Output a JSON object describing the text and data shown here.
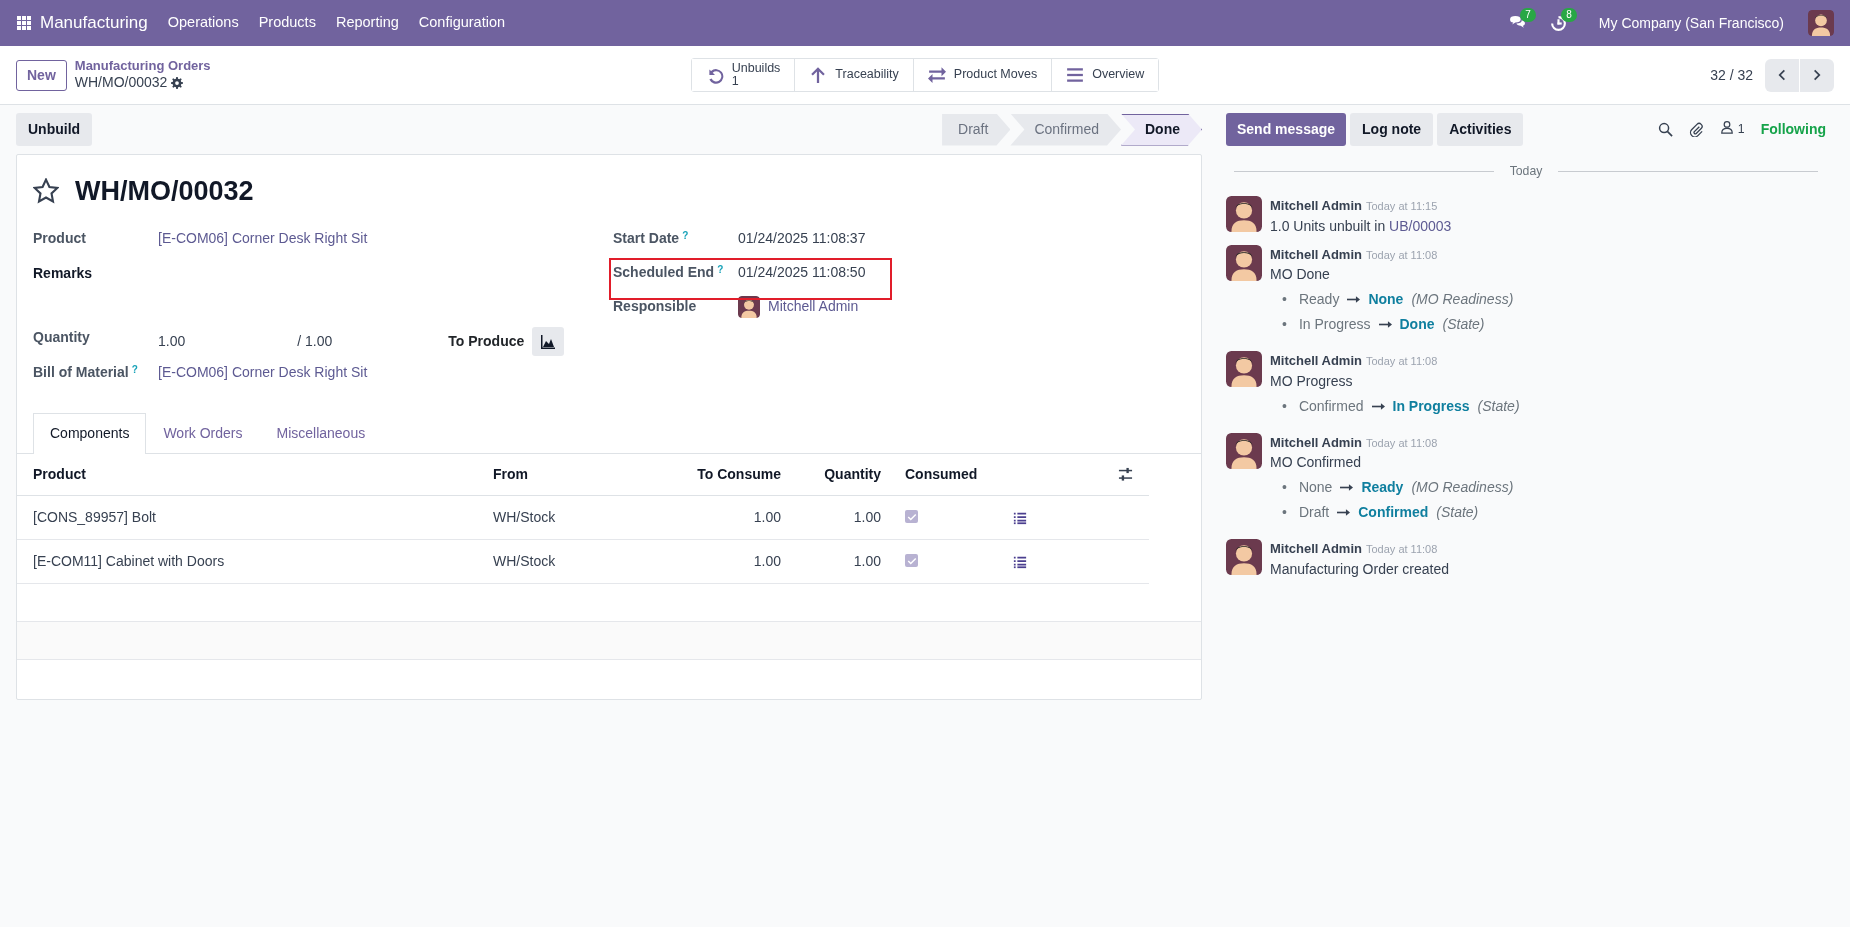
{
  "navbar": {
    "app": "Manufacturing",
    "menus": [
      "Operations",
      "Products",
      "Reporting",
      "Configuration"
    ],
    "messages_badge": "7",
    "activities_badge": "8",
    "company": "My Company (San Francisco)"
  },
  "control_panel": {
    "new_button": "New",
    "breadcrumb": "Manufacturing Orders",
    "record": "WH/MO/00032",
    "smart_buttons": [
      {
        "kind": "undo",
        "label": "Unbuilds",
        "count": "1"
      },
      {
        "kind": "arrow-up",
        "label": "Traceability"
      },
      {
        "kind": "exchange",
        "label": "Product Moves"
      },
      {
        "kind": "menu",
        "label": "Overview"
      }
    ],
    "pager": "32 / 32"
  },
  "action_buttons": [
    "Unbuild"
  ],
  "statusbar": [
    {
      "label": "Draft",
      "selected": false
    },
    {
      "label": "Confirmed",
      "selected": false
    },
    {
      "label": "Done",
      "selected": true
    }
  ],
  "form": {
    "starred": false,
    "title": "WH/MO/00032",
    "left_fields": [
      {
        "kind": "link",
        "label": "Product",
        "value": "[E-COM06] Corner Desk Right Sit"
      },
      {
        "kind": "section",
        "label": "Remarks"
      },
      {
        "kind": "quantity",
        "label": "Quantity",
        "value": "1.00",
        "total": "/ 1.00",
        "unit_label": "To Produce"
      },
      {
        "kind": "link",
        "label": "Bill of Material",
        "help": "?",
        "value": "[E-COM06] Corner Desk Right Sit"
      }
    ],
    "right_fields": [
      {
        "kind": "text",
        "label": "Start Date",
        "help": "?",
        "value": "01/24/2025 11:08:37"
      },
      {
        "kind": "text",
        "label": "Scheduled End",
        "help": "?",
        "value": "01/24/2025 11:08:50",
        "highlighted": true
      },
      {
        "kind": "user",
        "label": "Responsible",
        "value": "Mitchell Admin"
      }
    ]
  },
  "tabs": [
    {
      "label": "Components",
      "selected": true
    },
    {
      "label": "Work Orders",
      "selected": false
    },
    {
      "label": "Miscellaneous",
      "selected": false
    }
  ],
  "table": {
    "columns": [
      "Product",
      "From",
      "To Consume",
      "Quantity",
      "Consumed"
    ],
    "rows": [
      {
        "product": "[CONS_89957] Bolt",
        "from": "WH/Stock",
        "to_consume": "1.00",
        "quantity": "1.00",
        "consumed": true
      },
      {
        "product": "[E-COM11] Cabinet with Doors",
        "from": "WH/Stock",
        "to_consume": "1.00",
        "quantity": "1.00",
        "consumed": true
      }
    ]
  },
  "chatter": {
    "buttons": [
      {
        "label": "Send message",
        "selected": true
      },
      {
        "label": "Log note",
        "selected": false
      },
      {
        "label": "Activities",
        "selected": false
      }
    ],
    "followers_count": "1",
    "follow_label": "Following",
    "date_separator": "Today",
    "messages": [
      {
        "kind": "text",
        "author": "Mitchell Admin",
        "time": "Today at 11:15",
        "body": "1.0 Units unbuilt in ",
        "link": "UB/00003"
      },
      {
        "kind": "tracking",
        "author": "Mitchell Admin",
        "time": "Today at 11:08",
        "body": "MO Done",
        "changes": [
          {
            "bullet": "•",
            "old": "Ready",
            "new": "None",
            "field": "(MO Readiness)"
          },
          {
            "bullet": "•",
            "old": "In Progress",
            "new": "Done",
            "field": "(State)"
          }
        ]
      },
      {
        "kind": "tracking",
        "author": "Mitchell Admin",
        "time": "Today at 11:08",
        "body": "MO Progress",
        "changes": [
          {
            "bullet": "•",
            "old": "Confirmed",
            "new": "In Progress",
            "field": "(State)"
          }
        ]
      },
      {
        "kind": "tracking",
        "author": "Mitchell Admin",
        "time": "Today at 11:08",
        "body": "MO Confirmed",
        "changes": [
          {
            "bullet": "•",
            "old": "None",
            "new": "Ready",
            "field": "(MO Readiness)"
          },
          {
            "bullet": "•",
            "old": "Draft",
            "new": "Confirmed",
            "field": "(State)"
          }
        ]
      },
      {
        "kind": "text",
        "author": "Mitchell Admin",
        "time": "Today at 11:08",
        "body": "Manufacturing Order created"
      }
    ]
  }
}
